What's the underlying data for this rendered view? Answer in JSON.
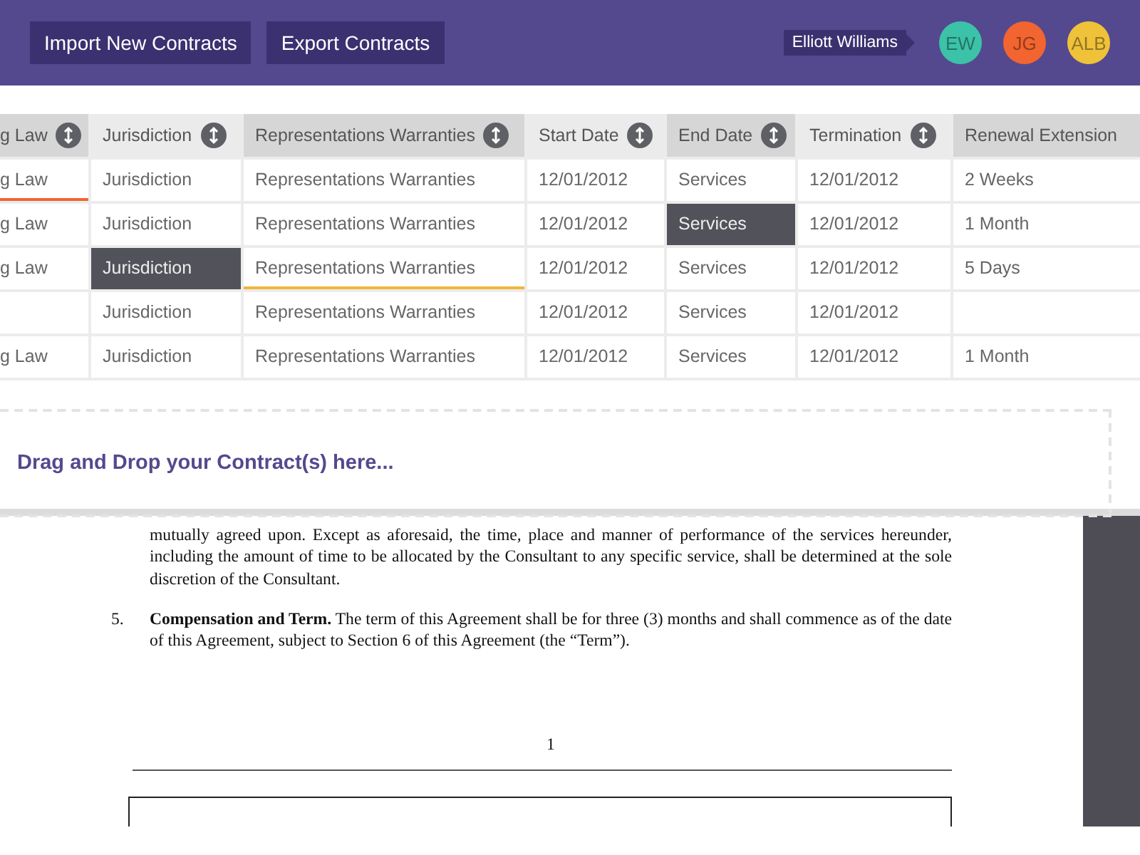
{
  "toolbar": {
    "buttons": [
      "Import New Contracts",
      "Export Contracts"
    ],
    "tooltip": "Elliott Williams",
    "avatars": [
      {
        "initials": "EW",
        "color": "#3cc2a8"
      },
      {
        "initials": "JG",
        "color": "#f26430"
      },
      {
        "initials": "ALB",
        "color": "#f0c23a"
      }
    ]
  },
  "table": {
    "columns": [
      {
        "label": "g Law",
        "sortable": true,
        "selected": true
      },
      {
        "label": "Jurisdiction",
        "sortable": true,
        "selected": false
      },
      {
        "label": "Representations Warranties",
        "sortable": true,
        "selected": true
      },
      {
        "label": "Start Date",
        "sortable": true,
        "selected": false
      },
      {
        "label": "End Date",
        "sortable": true,
        "selected": true
      },
      {
        "label": "Termination",
        "sortable": true,
        "selected": false
      },
      {
        "label": "Renewal Extension",
        "sortable": false,
        "selected": true
      }
    ],
    "rows": [
      [
        {
          "text": "g Law",
          "selected": false,
          "color": "#f26430"
        },
        {
          "text": "Jurisdiction",
          "selected": false
        },
        {
          "text": "Representations Warranties",
          "selected": false
        },
        {
          "text": "12/01/2012",
          "selected": false
        },
        {
          "text": "Services",
          "selected": false
        },
        {
          "text": "12/01/2012",
          "selected": false
        },
        {
          "text": "2 Weeks",
          "selected": false
        }
      ],
      [
        {
          "text": "g Law",
          "selected": false
        },
        {
          "text": "Jurisdiction",
          "selected": false
        },
        {
          "text": "Representations Warranties",
          "selected": false
        },
        {
          "text": "12/01/2012",
          "selected": false
        },
        {
          "text": "Services",
          "selected": true
        },
        {
          "text": "12/01/2012",
          "selected": false
        },
        {
          "text": "1 Month",
          "selected": false
        }
      ],
      [
        {
          "text": "g Law",
          "selected": false
        },
        {
          "text": "Jurisdiction",
          "selected": true
        },
        {
          "text": "Representations Warranties",
          "selected": false,
          "color": "#f0b73a"
        },
        {
          "text": "12/01/2012",
          "selected": false
        },
        {
          "text": "Services",
          "selected": false
        },
        {
          "text": "12/01/2012",
          "selected": false
        },
        {
          "text": "5 Days",
          "selected": false
        }
      ],
      [
        {
          "text": "",
          "selected": false
        },
        {
          "text": "Jurisdiction",
          "selected": false
        },
        {
          "text": "Representations Warranties",
          "selected": false
        },
        {
          "text": "12/01/2012",
          "selected": false
        },
        {
          "text": "Services",
          "selected": false
        },
        {
          "text": "12/01/2012",
          "selected": false
        },
        {
          "text": "",
          "selected": false
        }
      ],
      [
        {
          "text": "g Law",
          "selected": false
        },
        {
          "text": "Jurisdiction",
          "selected": false
        },
        {
          "text": "Representations Warranties",
          "selected": false
        },
        {
          "text": "12/01/2012",
          "selected": false
        },
        {
          "text": "Services",
          "selected": false
        },
        {
          "text": "12/01/2012",
          "selected": false
        },
        {
          "text": "1 Month",
          "selected": false
        }
      ]
    ]
  },
  "dropzone": {
    "text": "Drag and Drop your Contract(s) here..."
  },
  "document": {
    "paragraph": "mutually agreed upon.  Except as aforesaid, the time, place and manner of performance of the services hereunder, including the amount of time to be allocated by the Consultant to any specific service, shall be determined at the sole discretion of the Consultant.",
    "clause_number": "5.",
    "clause": "**Compensation and Term.**  The term of this Agreement shall be for three (3) months and shall commence as of the date of this Agreement, subject to Section 6 of this Agreement (the “Term”).",
    "page_number": "1"
  }
}
